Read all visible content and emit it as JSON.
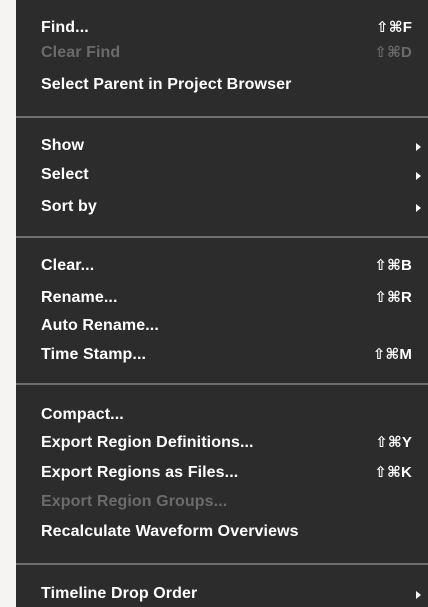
{
  "menu": {
    "items": [
      {
        "label": "Find...",
        "shortcut": "⇧⌘F"
      },
      {
        "label": "Clear Find",
        "shortcut": "⇧⌘D",
        "disabled": true
      },
      {
        "label": "Select Parent in Project Browser"
      },
      {
        "label": "Show",
        "submenu": true
      },
      {
        "label": "Select",
        "submenu": true
      },
      {
        "label": "Sort by",
        "submenu": true
      },
      {
        "label": "Clear...",
        "shortcut": "⇧⌘B"
      },
      {
        "label": "Rename...",
        "shortcut": "⇧⌘R"
      },
      {
        "label": "Auto Rename..."
      },
      {
        "label": "Time Stamp...",
        "shortcut": "⇧⌘M"
      },
      {
        "label": "Compact..."
      },
      {
        "label": "Export Region Definitions...",
        "shortcut": "⇧⌘Y"
      },
      {
        "label": "Export Regions as Files...",
        "shortcut": "⇧⌘K"
      },
      {
        "label": "Export Region Groups...",
        "disabled": true
      },
      {
        "label": "Recalculate Waveform Overviews"
      },
      {
        "label": "Timeline Drop Order",
        "submenu": true
      }
    ]
  }
}
